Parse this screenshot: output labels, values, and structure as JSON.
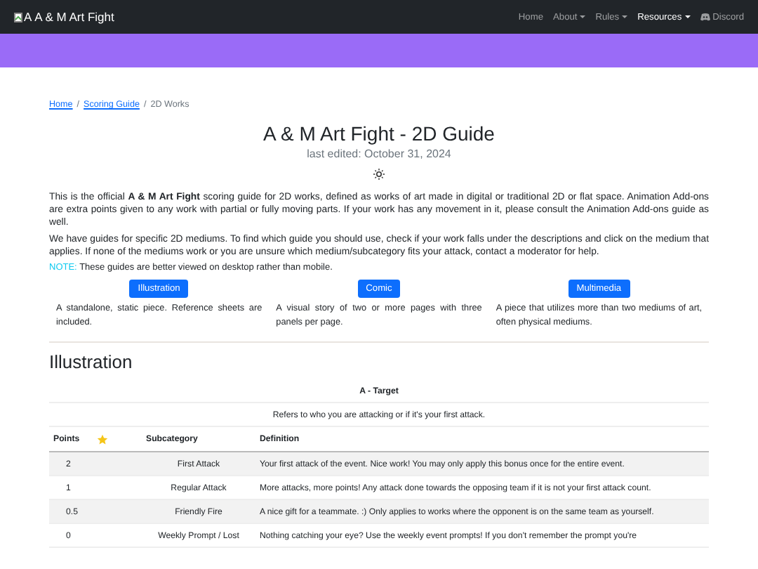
{
  "navbar": {
    "brand_image_alt": "A",
    "brand": "A & M Art Fight",
    "items": [
      {
        "label": "Home",
        "kind": "link",
        "selected": false
      },
      {
        "label": "About",
        "kind": "dropdown",
        "selected": false
      },
      {
        "label": "Rules",
        "kind": "dropdown",
        "selected": false
      },
      {
        "label": "Resources",
        "kind": "dropdown",
        "selected": true
      },
      {
        "label": "Discord",
        "kind": "discord",
        "selected": false
      }
    ]
  },
  "breadcrumb": [
    {
      "label": "Home",
      "kind": "link"
    },
    {
      "label": "/",
      "kind": "separator"
    },
    {
      "label": "Scoring Guide",
      "kind": "link"
    },
    {
      "label": "/",
      "kind": "separator"
    },
    {
      "label": "2D Works",
      "kind": "current"
    }
  ],
  "title": "A & M Art Fight - 2D Guide",
  "subtitle": "last edited: October 31, 2024",
  "intro": [
    "This is the official **A & M Art Fight** scoring guide for 2D works, defined as works of art made in digital or traditional 2D or flat space. Animation Add-ons are extra points given to any work with partial or fully moving parts. If your work has any movement in it, please consult the Animation Add-ons guide as well.",
    "We have guides for specific 2D mediums. To find which guide you should use, check if your work falls under the descriptions and click on the medium that applies. If none of the mediums work or you are unsure which medium/subcategory fits your attack, contact a moderator for help."
  ],
  "note": {
    "label": "NOTE:",
    "text": "These guides are better viewed on desktop rather than mobile."
  },
  "mediums": [
    {
      "button": "Illustration",
      "description": "A standalone, static piece. Reference sheets are included."
    },
    {
      "button": "Comic",
      "description": "A visual story of two or more pages with three panels per page."
    },
    {
      "button": "Multimedia",
      "description": "A piece that utilizes more than two mediums of art, often physical mediums."
    }
  ],
  "section_heading": "Illustration",
  "table": {
    "caption": "A - Target",
    "description": "Refers to who you are attacking or if it's your first attack.",
    "columns": [
      "Points",
      "Subcategory",
      "Definition"
    ],
    "rows": [
      [
        "2",
        "First Attack",
        "Your first attack of the event. Nice work! You may only apply this bonus once for the entire event."
      ],
      [
        "1",
        "Regular Attack",
        "More attacks, more points! Any attack done towards the opposing team if it is not your first attack count."
      ],
      [
        "0.5",
        "Friendly Fire",
        "A nice gift for a teammate. :) Only applies to works where the opponent is on the same team as yourself."
      ],
      [
        "0",
        "Weekly Prompt / Lost",
        "Nothing catching your eye? Use the weekly event prompts! If you don't remember the prompt you're"
      ]
    ]
  }
}
